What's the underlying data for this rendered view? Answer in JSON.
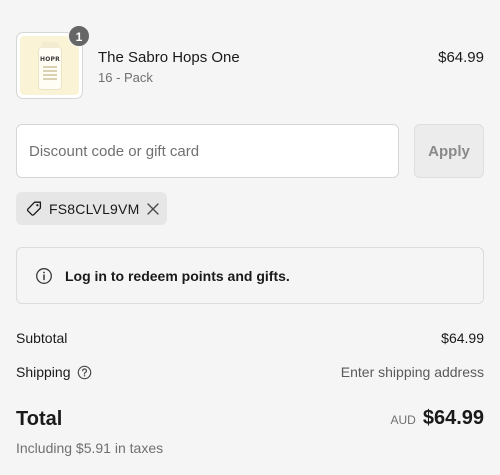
{
  "line_item": {
    "quantity": "1",
    "name": "The Sabro Hops One",
    "variant": "16 - Pack",
    "price": "$64.99",
    "image_logo": "HOPR"
  },
  "discount": {
    "placeholder": "Discount code or gift card",
    "value": "",
    "apply_label": "Apply",
    "applied_code": "FS8CLVL9VM",
    "tag_icon": "tag-icon",
    "remove_icon": "close-icon"
  },
  "login_notice": {
    "icon": "info-icon",
    "text": "Log in to redeem points and gifts."
  },
  "summary": {
    "subtotal_label": "Subtotal",
    "subtotal_value": "$64.99",
    "shipping_label": "Shipping",
    "shipping_help_icon": "question-circle-icon",
    "shipping_value": "Enter shipping address",
    "total_label": "Total",
    "currency": "AUD",
    "total_value": "$64.99",
    "taxes_note": "Including $5.91 in taxes"
  },
  "colors": {
    "background": "#f5f5f5",
    "text": "#1a1a1a",
    "muted_text": "#707070",
    "badge": "#666666",
    "tag_background": "#e6e6e6"
  }
}
